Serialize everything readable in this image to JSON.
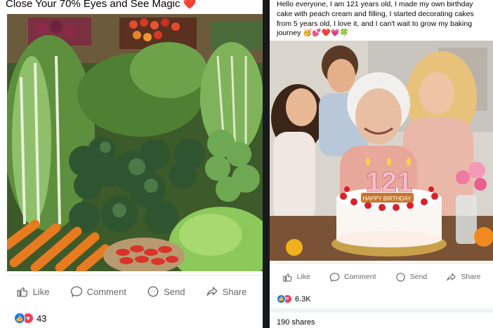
{
  "left_post": {
    "caption": "Close Your 70% Eyes and See Magic ❤️",
    "actions": {
      "like": "Like",
      "comment": "Comment",
      "send": "Send",
      "share": "Share"
    },
    "reaction_count": "43"
  },
  "right_post": {
    "caption": "Hello everyone, I am 121 years old, I made my own birthday cake with peach cream and filling, I started decorating cakes from 5 years old, I love it, and I can't wait to grow my baking journey 🥳💕❤️💗🍀",
    "cake_number": "121",
    "cake_banner": "HAPPY BIRTHDAY",
    "actions": {
      "like": "Like",
      "comment": "Comment",
      "send": "Send",
      "share": "Share"
    },
    "reaction_count": "6.3K",
    "shares": "190 shares"
  },
  "colors": {
    "facebook_blue": "#1877f2",
    "love_red": "#f33e58",
    "action_gray": "#65676b"
  }
}
